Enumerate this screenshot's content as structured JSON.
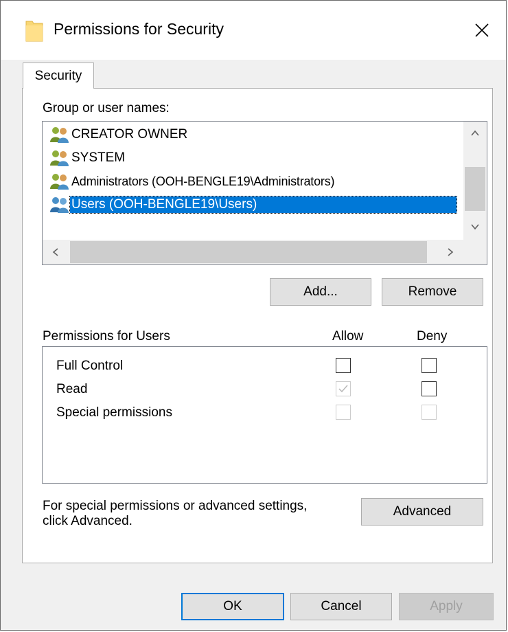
{
  "window": {
    "title": "Permissions for Security"
  },
  "tabs": [
    {
      "label": "Security"
    }
  ],
  "group_label": "Group or user names:",
  "users": [
    {
      "name": "CREATOR OWNER",
      "selected": false
    },
    {
      "name": "SYSTEM",
      "selected": false
    },
    {
      "name": "Administrators (OOH-BENGLE19\\Administrators)",
      "selected": false
    },
    {
      "name": "Users (OOH-BENGLE19\\Users)",
      "selected": true
    }
  ],
  "buttons": {
    "add": "Add...",
    "remove": "Remove",
    "advanced": "Advanced",
    "ok": "OK",
    "cancel": "Cancel",
    "apply": "Apply"
  },
  "permissions": {
    "header": "Permissions for Users",
    "allow_label": "Allow",
    "deny_label": "Deny",
    "rows": [
      {
        "name": "Full Control",
        "allow": false,
        "deny": false,
        "allow_enabled": true,
        "deny_enabled": true
      },
      {
        "name": "Read",
        "allow": true,
        "deny": false,
        "allow_enabled": false,
        "deny_enabled": true
      },
      {
        "name": "Special permissions",
        "allow": false,
        "deny": false,
        "allow_enabled": false,
        "deny_enabled": false
      }
    ]
  },
  "advanced_hint": {
    "line1": "For special permissions or advanced settings,",
    "line2": "click Advanced."
  },
  "colors": {
    "selection": "#0078d7",
    "accent": "#0078d7"
  }
}
